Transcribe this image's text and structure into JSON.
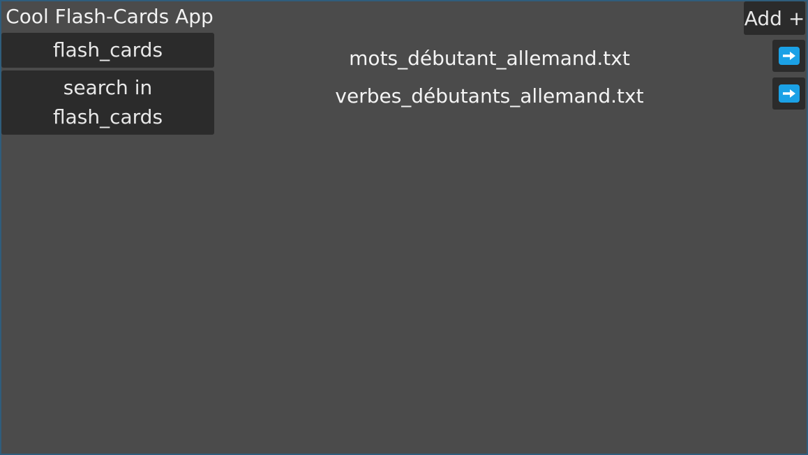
{
  "app": {
    "title": "Cool Flash-Cards App"
  },
  "sidebar": {
    "folder_label": "flash_cards",
    "search_label": "search in flash_cards"
  },
  "toolbar": {
    "add_label": "Add +"
  },
  "files": [
    {
      "name": "mots_débutant_allemand.txt",
      "open_icon": "arrow-right-icon"
    },
    {
      "name": "verbes_débutants_allemand.txt",
      "open_icon": "arrow-right-icon"
    }
  ],
  "colors": {
    "background": "#4b4b4b",
    "button": "#2b2b2b",
    "accent": "#1ba1e6",
    "text": "#ececec"
  }
}
